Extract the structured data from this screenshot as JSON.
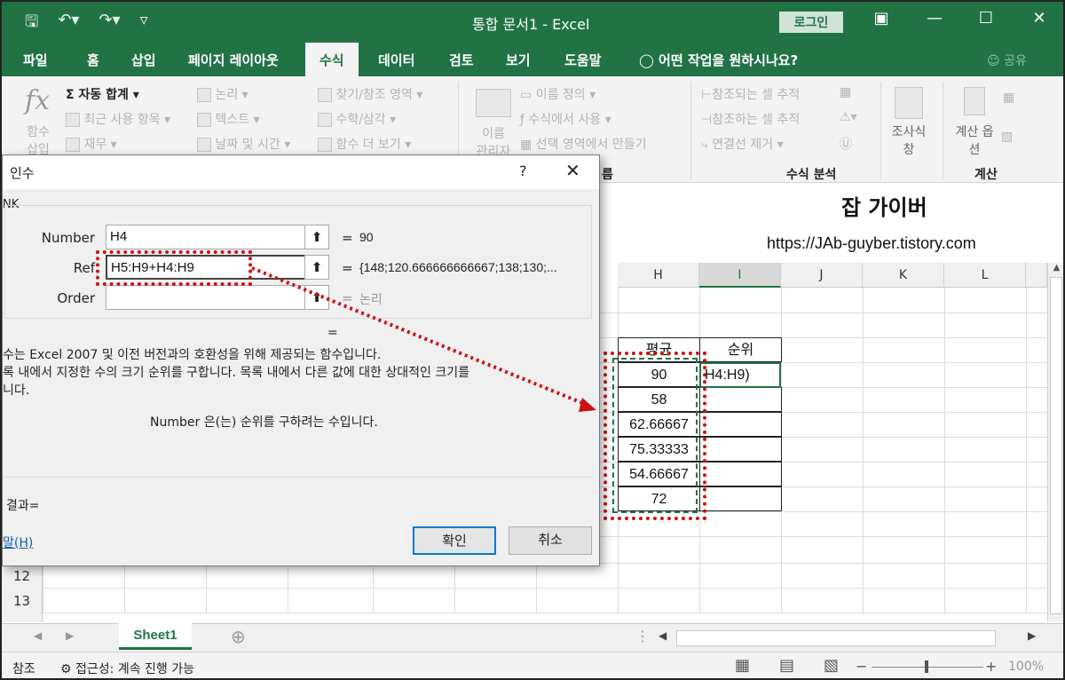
{
  "window": {
    "title": "통합 문서1 - Excel",
    "login_label": "로그인"
  },
  "tabs": [
    "파일",
    "홈",
    "삽입",
    "페이지 레이아웃",
    "수식",
    "데이터",
    "검토",
    "보기",
    "도움말"
  ],
  "active_tab": "수식",
  "tell_me": "어떤 작업을 원하시나요?",
  "share": "공유",
  "ribbon": {
    "insert_function": "함수 삽입",
    "autosum": "자동 합계",
    "recent": "최근 사용 항목",
    "financial": "재무",
    "logical": "논리",
    "text": "텍스트",
    "datetime": "날짜 및 시간",
    "lookup": "찾기/참조 영역",
    "math": "수학/삼각",
    "more": "함수 더 보기",
    "name_manager": "이름 관리자",
    "define_name": "이름 정의",
    "use_in_formula": "수식에서 사용",
    "create_from_sel": "선택 영역에서 만들기",
    "trace_precedents": "참조되는 셀 추적",
    "trace_dependents": "참조하는 셀 추적",
    "remove_arrows": "연결선 제거",
    "watch_window": "조사식 창",
    "calc_options": "계산 옵션",
    "group_formula_audit": "수식 분석",
    "group_calc": "계산",
    "group_names": "름"
  },
  "brand": {
    "name": "잡 가이버",
    "url": "https://JAb-guyber.tistory.com"
  },
  "columns": [
    "H",
    "I",
    "J",
    "K",
    "L"
  ],
  "rows": [
    "12",
    "13"
  ],
  "table": {
    "header_avg": "평균",
    "header_rank": "순위",
    "values": [
      "90",
      "58",
      "62.66667",
      "75.33333",
      "54.66667",
      "72"
    ],
    "active_cell_text": "H4:H9)"
  },
  "dialog": {
    "title": "인수",
    "func_name": "NK",
    "args": [
      {
        "label": "Number",
        "value": "H4",
        "result": "90"
      },
      {
        "label": "Ref",
        "value": "H5:H9+H4:H9",
        "result": "{148;120.666666666667;138;130;..."
      },
      {
        "label": "Order",
        "value": "",
        "result": "논리"
      }
    ],
    "equals": "=",
    "desc_line1": "수는 Excel 2007 및 이전 버전과의 호환성을 위해 제공되는 함수입니다.",
    "desc_line2": "록 내에서 지정한 수의 크기 순위를 구합니다. 목록 내에서 다른 값에 대한 상대적인 크기를",
    "desc_line3": "니다.",
    "arg_help": "Number  은(는) 순위를 구하려는 수입니다.",
    "result_label": "결과=",
    "help_link": "말(H)",
    "ok": "확인",
    "cancel": "취소",
    "help_btn": "?"
  },
  "sheet": {
    "tab": "Sheet1"
  },
  "status": {
    "mode": "참조",
    "accessibility": "접근성: 계속 진행 가능",
    "zoom": "100%"
  }
}
